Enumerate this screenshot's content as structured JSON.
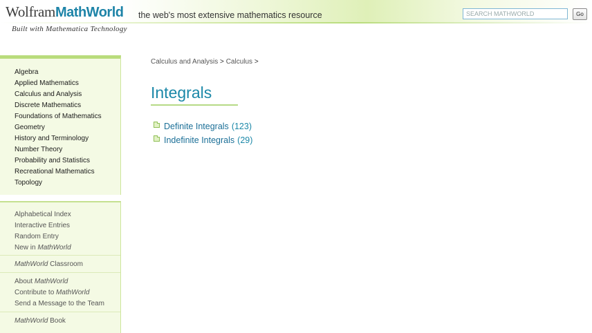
{
  "header": {
    "logo_word1": "Wolfram",
    "logo_word2": "MathWorld",
    "tagline": "the web's most extensive mathematics resource",
    "subtagline": "Built with Mathematica Technology",
    "search_placeholder": "SEARCH MATHWORLD",
    "search_value": "",
    "go_label": "Go"
  },
  "sidebar": {
    "topics": [
      "Algebra",
      "Applied Mathematics",
      "Calculus and Analysis",
      "Discrete Mathematics",
      "Foundations of Mathematics",
      "Geometry",
      "History and Terminology",
      "Number Theory",
      "Probability and Statistics",
      "Recreational Mathematics",
      "Topology"
    ],
    "links": {
      "alphabetical_index": "Alphabetical Index",
      "interactive_entries": "Interactive Entries",
      "random_entry": "Random Entry",
      "new_in_prefix": "New in ",
      "new_in_em": "MathWorld",
      "classroom_em": "MathWorld",
      "classroom_suffix": " Classroom",
      "about_prefix": "About ",
      "about_em": "MathWorld",
      "contribute_prefix": "Contribute to ",
      "contribute_em": "MathWorld",
      "send_message": "Send a Message to the Team",
      "book_em": "MathWorld",
      "book_suffix": " Book"
    }
  },
  "main": {
    "breadcrumb": [
      {
        "label": "Calculus and Analysis",
        "sep": " > "
      },
      {
        "label": "Calculus",
        "sep": " >"
      }
    ],
    "title": "Integrals",
    "categories": [
      {
        "name": "Definite Integrals",
        "count": "(123)"
      },
      {
        "name": "Indefinite Integrals",
        "count": "(29)"
      }
    ]
  },
  "colors": {
    "accent": "#1b88a8",
    "sidebar_bg": "#f4fae4",
    "sidebar_border": "#b9dc7c"
  }
}
